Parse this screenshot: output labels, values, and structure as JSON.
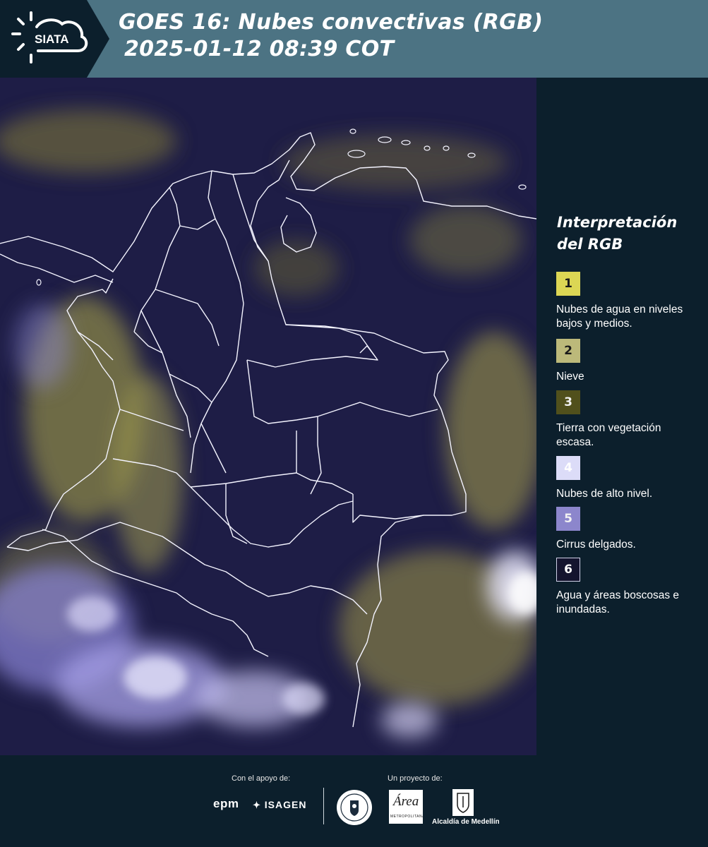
{
  "header": {
    "logo_text": "SIATA",
    "title_line1": "GOES 16: Nubes convectivas (RGB)",
    "title_line2": "2025-01-12 08:39 COT"
  },
  "legend": {
    "title_line1": "Interpretación",
    "title_line2": "del RGB",
    "items": [
      {
        "number": "1",
        "label": "Nubes de agua en niveles bajos y medios.",
        "color": "#dcd654"
      },
      {
        "number": "2",
        "label": "Nieve",
        "color": "#bcb97a"
      },
      {
        "number": "3",
        "label": "Tierra con vegetación escasa.",
        "color": "#51501c"
      },
      {
        "number": "4",
        "label": "Nubes de alto nivel.",
        "color": "#dcdcf8"
      },
      {
        "number": "5",
        "label": "Cirrus delgados.",
        "color": "#8c86cc"
      },
      {
        "number": "6",
        "label": "Agua y áreas boscosas e inundadas.",
        "color": "#14142e"
      }
    ]
  },
  "footer": {
    "support_caption": "Con el apoyo de:",
    "project_caption": "Un proyecto de:",
    "sponsors": [
      "epm",
      "ISAGEN"
    ],
    "area_logo_text": "Área",
    "area_logo_subtext": "METROPOLITANA Valle de Aburrá",
    "alcaldia_text": "Alcaldía de Medellín"
  }
}
